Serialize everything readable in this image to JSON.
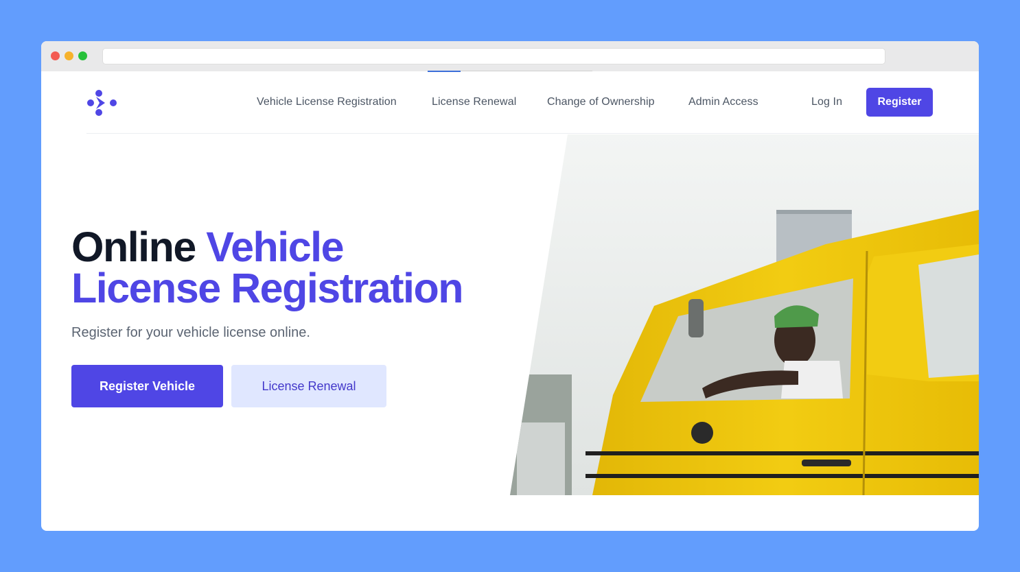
{
  "nav": {
    "links": [
      {
        "label": "Vehicle License Registration"
      },
      {
        "label": "License Renewal"
      },
      {
        "label": "Change of Ownership"
      },
      {
        "label": "Admin Access"
      }
    ],
    "login_label": "Log In",
    "register_label": "Register"
  },
  "hero": {
    "title_part1": "Online ",
    "title_part2": "Vehicle",
    "title_line2": "License Registration",
    "subtitle": "Register for your vehicle license online.",
    "primary_cta": "Register Vehicle",
    "secondary_cta": "License Renewal"
  },
  "colors": {
    "background": "#629dfd",
    "accent": "#4f46e5",
    "secondary_button_bg": "#e0e7ff",
    "heading": "#111827"
  },
  "icons": [
    "brand-logo-icon"
  ]
}
